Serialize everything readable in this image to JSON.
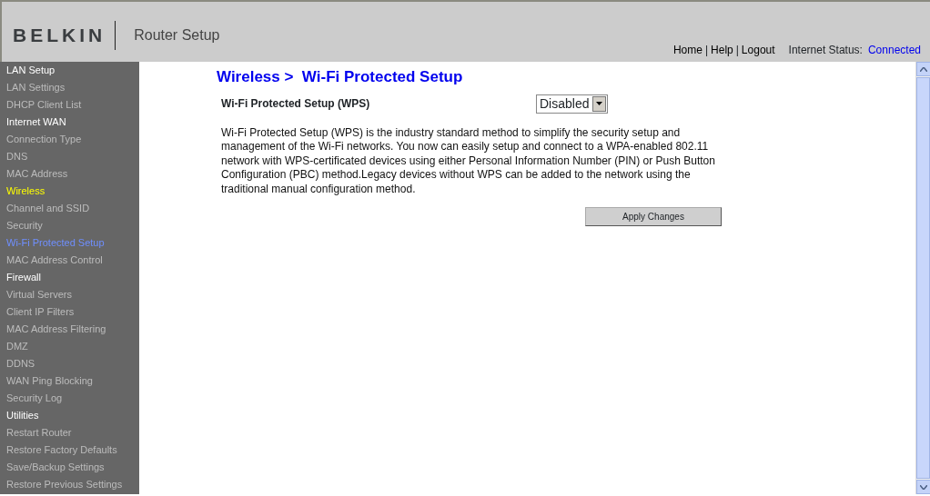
{
  "header": {
    "logo": "BELKIN",
    "title": "Router Setup",
    "links": [
      "Home",
      "Help",
      "Logout"
    ],
    "link_separator": "|",
    "status_label": "Internet Status:",
    "status_value": "Connected"
  },
  "sidebar": {
    "sections": [
      {
        "label": "LAN Setup",
        "selected": false,
        "children": [
          {
            "label": "LAN Settings",
            "selected": false
          },
          {
            "label": "DHCP Client List",
            "selected": false
          }
        ]
      },
      {
        "label": "Internet WAN",
        "selected": false,
        "children": [
          {
            "label": "Connection Type",
            "selected": false
          },
          {
            "label": "DNS",
            "selected": false
          },
          {
            "label": "MAC Address",
            "selected": false
          }
        ]
      },
      {
        "label": "Wireless",
        "selected": true,
        "children": [
          {
            "label": "Channel and SSID",
            "selected": false
          },
          {
            "label": "Security",
            "selected": false
          },
          {
            "label": "Wi-Fi Protected Setup",
            "selected": true
          },
          {
            "label": "MAC Address Control",
            "selected": false
          }
        ]
      },
      {
        "label": "Firewall",
        "selected": false,
        "children": [
          {
            "label": "Virtual Servers",
            "selected": false
          },
          {
            "label": "Client IP Filters",
            "selected": false
          },
          {
            "label": "MAC Address Filtering",
            "selected": false
          },
          {
            "label": "DMZ",
            "selected": false
          },
          {
            "label": "DDNS",
            "selected": false
          },
          {
            "label": "WAN Ping Blocking",
            "selected": false
          },
          {
            "label": "Security Log",
            "selected": false
          }
        ]
      },
      {
        "label": "Utilities",
        "selected": false,
        "children": [
          {
            "label": "Restart Router",
            "selected": false
          },
          {
            "label": "Restore Factory Defaults",
            "selected": false
          },
          {
            "label": "Save/Backup Settings",
            "selected": false
          },
          {
            "label": "Restore Previous Settings",
            "selected": false
          }
        ]
      }
    ]
  },
  "content": {
    "breadcrumb": "Wireless >",
    "title": "Wi-Fi Protected Setup",
    "setting": {
      "label": "Wi-Fi Protected Setup (WPS)",
      "value": "Disabled"
    },
    "description": "Wi-Fi Protected Setup (WPS) is the industry standard method to simplify the security setup and management of the Wi-Fi networks. You now can easily setup and connect to a WPA-enabled 802.11 network with WPS-certificated devices using either Personal Information Number (PIN) or Push Button Configuration (PBC) method.Legacy devices without WPS can be added to the network using the traditional manual configuration method.",
    "button": "Apply Changes"
  }
}
